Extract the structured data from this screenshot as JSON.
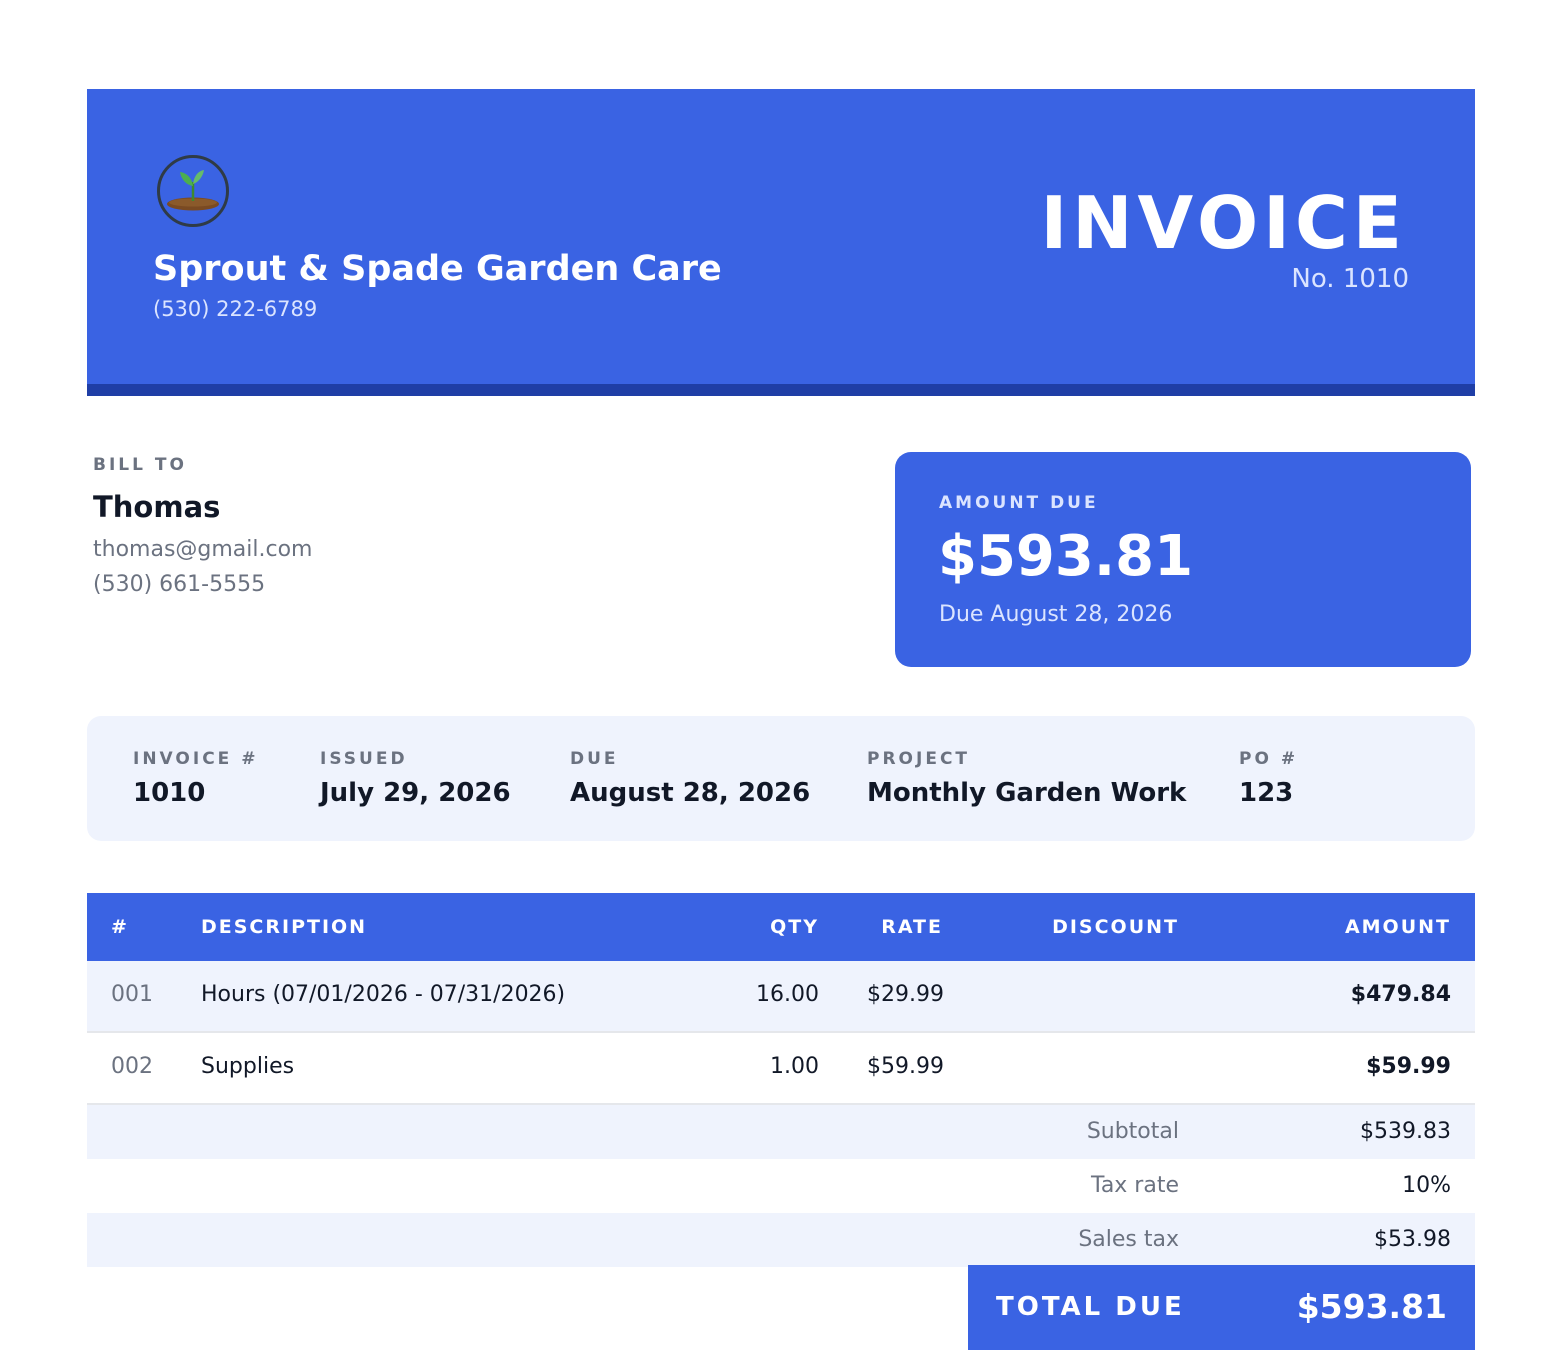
{
  "header": {
    "logo_icon": "seedling-logo",
    "company_name": "Sprout & Spade Garden Care",
    "company_phone": "(530) 222-6789",
    "title": "INVOICE",
    "invoice_no": "No. 1010",
    "colors": {
      "primary": "#3a63e3",
      "accent_bar": "#1f3ea6"
    }
  },
  "bill_to": {
    "label": "BILL TO",
    "name": "Thomas",
    "email": "thomas@gmail.com",
    "phone": "(530) 661-5555"
  },
  "amount_due": {
    "label": "AMOUNT DUE",
    "value": "$593.81",
    "due_text": "Due August 28, 2026"
  },
  "meta": [
    {
      "label": "INVOICE #",
      "value": "1010"
    },
    {
      "label": "ISSUED",
      "value": "July 29, 2026"
    },
    {
      "label": "DUE",
      "value": "August 28, 2026"
    },
    {
      "label": "PROJECT",
      "value": "Monthly Garden Work"
    },
    {
      "label": "PO #",
      "value": "123"
    }
  ],
  "table": {
    "headers": {
      "num": "#",
      "description": "DESCRIPTION",
      "qty": "QTY",
      "rate": "RATE",
      "discount": "DISCOUNT",
      "amount": "AMOUNT"
    },
    "rows": [
      {
        "num": "001",
        "description": "Hours (07/01/2026 - 07/31/2026)",
        "qty": "16.00",
        "rate": "$29.99",
        "discount": "",
        "amount": "$479.84"
      },
      {
        "num": "002",
        "description": "Supplies",
        "qty": "1.00",
        "rate": "$59.99",
        "discount": "",
        "amount": "$59.99"
      }
    ]
  },
  "summary": [
    {
      "label": "Subtotal",
      "value": "$539.83"
    },
    {
      "label": "Tax rate",
      "value": "10%"
    },
    {
      "label": "Sales tax",
      "value": "$53.98"
    }
  ],
  "total": {
    "label": "TOTAL DUE",
    "value": "$593.81"
  }
}
